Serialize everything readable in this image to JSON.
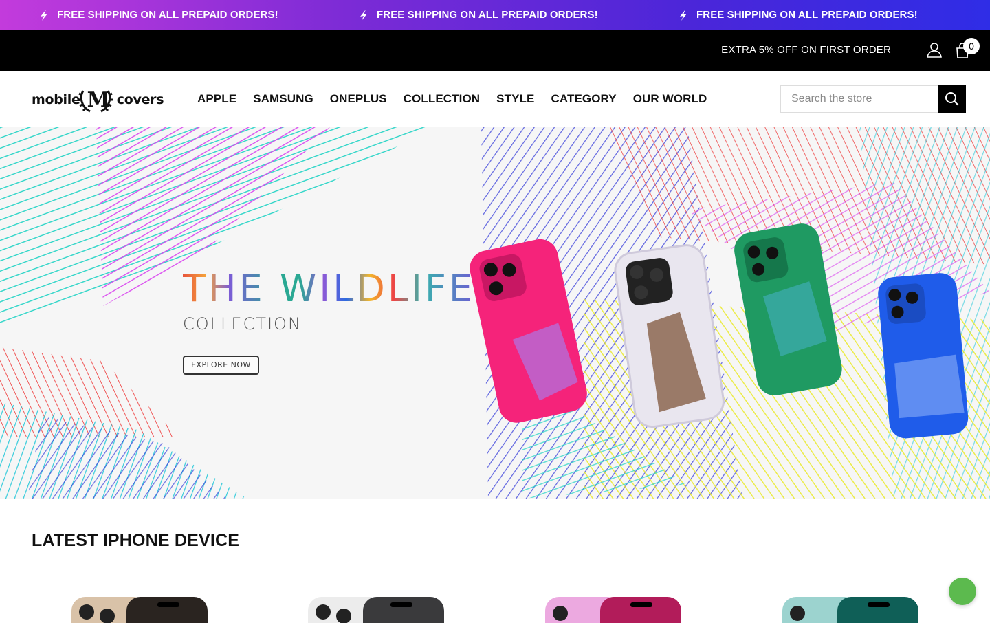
{
  "announcement": {
    "items": [
      "FREE SHIPPING ON ALL PREPAID ORDERS!",
      "FREE SHIPPING ON ALL PREPAID ORDERS!",
      "FREE SHIPPING ON ALL PREPAID ORDERS!"
    ]
  },
  "topbar": {
    "offer": "EXTRA 5% OFF ON FIRST ORDER",
    "cart_count": "0"
  },
  "header": {
    "logo_left": "mobile",
    "logo_mid": "M",
    "logo_right": "covers",
    "nav": [
      "APPLE",
      "SAMSUNG",
      "ONEPLUS",
      "COLLECTION",
      "STYLE",
      "CATEGORY",
      "OUR WORLD"
    ],
    "search_placeholder": "Search the store"
  },
  "hero": {
    "title": "THE WILDLIFE",
    "subtitle": "COLLECTION",
    "button": "EXPLORE NOW"
  },
  "section": {
    "title": "LATEST IPHONE DEVICE"
  },
  "colors": {
    "announce_gradient": [
      "#c33bdc",
      "#2f2de6"
    ],
    "chat": "#5cba4e"
  }
}
